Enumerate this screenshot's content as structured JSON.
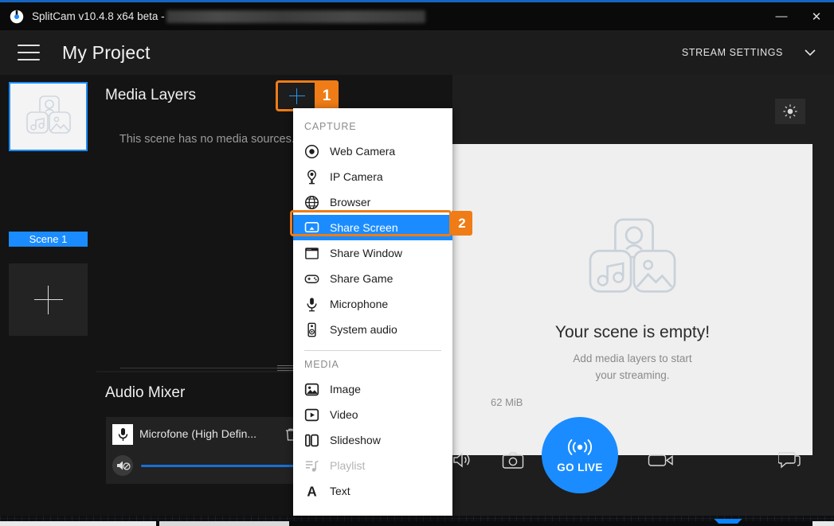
{
  "window": {
    "title": "SplitCam v10.4.8 x64 beta -",
    "minimize_label": "—",
    "close_label": "✕"
  },
  "header": {
    "menu_icon": "hamburger-icon",
    "project_title": "My Project",
    "stream_settings_label": "STREAM SETTINGS",
    "chevron": "⌄"
  },
  "scenes": {
    "scene_label": "Scene 1",
    "add_scene_icon": "plus-icon"
  },
  "layers": {
    "title": "Media Layers",
    "add_icon": "plus-icon",
    "badge": "1",
    "empty_text": "This scene has no media sources. Add a layer to get started."
  },
  "mixer": {
    "title": "Audio Mixer",
    "device_name": "Microfone (High Defin...",
    "mic_icon": "microphone-icon",
    "delete_icon": "trash-icon",
    "mute_icon": "speaker-mute-icon",
    "volume": 100
  },
  "preview": {
    "brightness_icon": "brightness-icon",
    "empty_title": "Your scene is empty!",
    "empty_sub_line1": "Add media layers to start",
    "empty_sub_line2": "your streaming.",
    "memory": "62 MiB"
  },
  "controls": {
    "speaker_icon": "speaker-icon",
    "snapshot_icon": "camera-icon",
    "record_icon": "video-camera-icon",
    "chat_icon": "chat-icon",
    "go_live_label": "GO LIVE",
    "go_live_icon": "broadcast-icon"
  },
  "dropdown": {
    "badge": "2",
    "sections": [
      {
        "label": "CAPTURE",
        "items": [
          {
            "label": "Web Camera",
            "icon": "web-camera-icon",
            "selected": false,
            "disabled": false
          },
          {
            "label": "IP Camera",
            "icon": "ip-camera-icon",
            "selected": false,
            "disabled": false
          },
          {
            "label": "Browser",
            "icon": "globe-icon",
            "selected": false,
            "disabled": false
          },
          {
            "label": "Share Screen",
            "icon": "monitor-icon",
            "selected": true,
            "disabled": false
          },
          {
            "label": "Share Window",
            "icon": "window-icon",
            "selected": false,
            "disabled": false
          },
          {
            "label": "Share Game",
            "icon": "gamepad-icon",
            "selected": false,
            "disabled": false
          },
          {
            "label": "Microphone",
            "icon": "microphone-icon",
            "selected": false,
            "disabled": false
          },
          {
            "label": "System audio",
            "icon": "system-audio-icon",
            "selected": false,
            "disabled": false
          }
        ]
      },
      {
        "label": "MEDIA",
        "items": [
          {
            "label": "Image",
            "icon": "image-icon",
            "selected": false,
            "disabled": false
          },
          {
            "label": "Video",
            "icon": "video-icon",
            "selected": false,
            "disabled": false
          },
          {
            "label": "Slideshow",
            "icon": "slideshow-icon",
            "selected": false,
            "disabled": false
          },
          {
            "label": "Playlist",
            "icon": "playlist-icon",
            "selected": false,
            "disabled": true
          },
          {
            "label": "Text",
            "icon": "text-icon",
            "selected": false,
            "disabled": false
          }
        ]
      }
    ]
  },
  "colors": {
    "accent_blue": "#1a8cff",
    "highlight_orange": "#ef7c17",
    "panel_dark": "#141414",
    "canvas_light": "#efefef"
  }
}
